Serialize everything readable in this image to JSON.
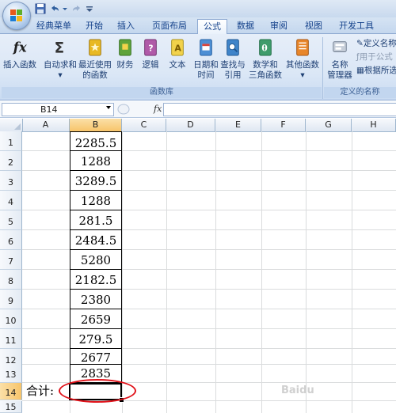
{
  "ribbon": {
    "tabs": [
      {
        "id": "classic",
        "label": "经典菜单"
      },
      {
        "id": "start",
        "label": "开始"
      },
      {
        "id": "insert",
        "label": "插入"
      },
      {
        "id": "page_layout",
        "label": "页面布局"
      },
      {
        "id": "formulas",
        "label": "公式",
        "active": true
      },
      {
        "id": "data",
        "label": "数据"
      },
      {
        "id": "review",
        "label": "审阅"
      },
      {
        "id": "view",
        "label": "视图"
      },
      {
        "id": "developer",
        "label": "开发工具"
      }
    ],
    "buttons": {
      "insert_function": "插入函数",
      "autosum": "自动求和",
      "recent_1": "最近使用",
      "recent_2": "的函数",
      "financial": "财务",
      "logical": "逻辑",
      "text": "文本",
      "datetime_1": "日期和",
      "datetime_2": "时间",
      "lookup_1": "查找与",
      "lookup_2": "引用",
      "math_1": "数学和",
      "math_2": "三角函数",
      "other": "其他函数",
      "name_mgr_1": "名称",
      "name_mgr_2": "管理器"
    },
    "defined_names": {
      "define_name": "定义名称",
      "use_in_formula": "用于公式",
      "create_from_selection": "根据所选"
    },
    "group_labels": {
      "function_library": "函数库",
      "defined_names": "定义的名称"
    }
  },
  "formula_bar": {
    "name_box": "B14",
    "fx_label": "fx",
    "formula": ""
  },
  "sheet": {
    "columns": [
      "A",
      "B",
      "C",
      "D",
      "E",
      "F",
      "G",
      "H"
    ],
    "row_numbers": [
      "1",
      "2",
      "3",
      "4",
      "5",
      "6",
      "7",
      "8",
      "9",
      "10",
      "11",
      "12",
      "13",
      "14",
      "15"
    ],
    "b_values": [
      "2285.5",
      "1288",
      "3289.5",
      "1288",
      "281.5",
      "2484.5",
      "5280",
      "2182.5",
      "2380",
      "2659",
      "279.5",
      "2677",
      "2835"
    ],
    "a14_label": "合计:",
    "selected_cell": "B14"
  },
  "colors": {
    "accent": "#15428b",
    "highlight_ellipse": "#e0121a",
    "selected_header": "#f7c46a"
  }
}
